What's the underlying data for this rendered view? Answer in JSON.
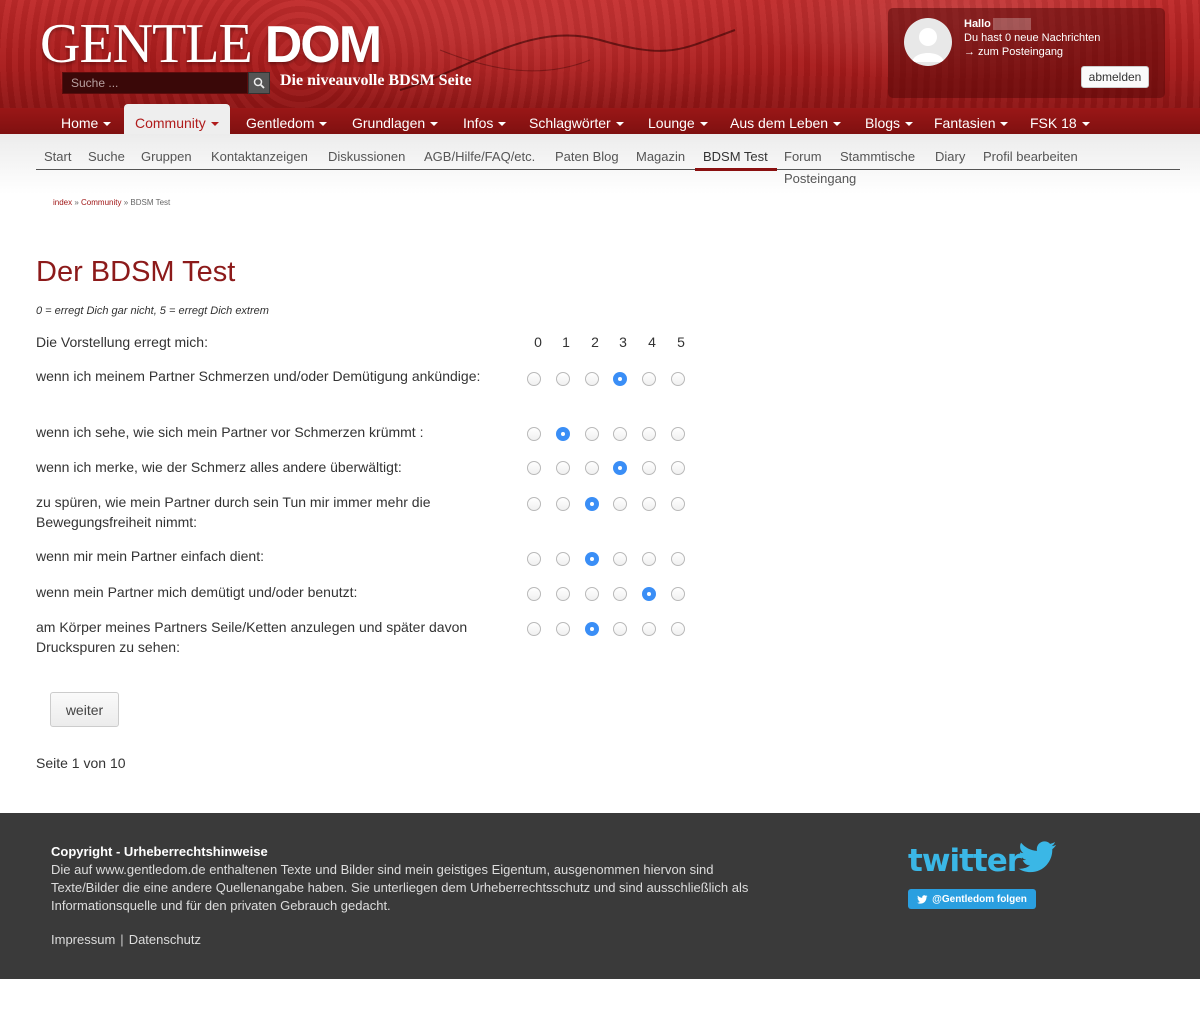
{
  "header": {
    "logo_part1": "GENTLE",
    "logo_part2": "DOM",
    "tagline": "Die niveauvolle BDSM Seite",
    "search_placeholder": "Suche ...",
    "search_icon": "search-icon"
  },
  "user": {
    "hello": "Hallo",
    "messages": "Du hast 0 neue Nachrichten",
    "inbox_link": "→ zum Posteingang",
    "logout": "abmelden",
    "avatar_icon": "user-avatar-icon"
  },
  "main_nav": [
    {
      "label": "Home"
    },
    {
      "label": "Community",
      "active": true
    },
    {
      "label": "Gentledom"
    },
    {
      "label": "Grundlagen"
    },
    {
      "label": "Infos"
    },
    {
      "label": "Schlagwörter"
    },
    {
      "label": "Lounge"
    },
    {
      "label": "Aus dem Leben"
    },
    {
      "label": "Blogs"
    },
    {
      "label": "Fantasien"
    },
    {
      "label": "FSK 18"
    }
  ],
  "sub_nav": [
    {
      "label": "Start"
    },
    {
      "label": "Suche"
    },
    {
      "label": "Gruppen"
    },
    {
      "label": "Kontaktanzeigen"
    },
    {
      "label": "Diskussionen"
    },
    {
      "label": "AGB/Hilfe/FAQ/etc."
    },
    {
      "label": "Paten Blog"
    },
    {
      "label": "Magazin"
    },
    {
      "label": "BDSM Test",
      "active": true
    },
    {
      "label": "Forum"
    },
    {
      "label": "Stammtische"
    },
    {
      "label": "Diary"
    },
    {
      "label": "Profil bearbeiten"
    },
    {
      "label": "Posteingang"
    }
  ],
  "breadcrumb": {
    "index": "index",
    "sep1": " » ",
    "community": "Community",
    "sep2": " » ",
    "current": "BDSM Test"
  },
  "test": {
    "title": "Der BDSM Test",
    "legend": "0 = erregt Dich gar nicht, 5 = erregt Dich extrem",
    "intro": "Die Vorstellung erregt mich:",
    "scale": [
      "0",
      "1",
      "2",
      "3",
      "4",
      "5"
    ],
    "questions": [
      {
        "text": "wenn ich meinem Partner Schmerzen und/oder Demütigung ankündige:",
        "selected": 3
      },
      {
        "text": "wenn ich sehe, wie sich mein Partner vor Schmerzen krümmt :",
        "selected": 1
      },
      {
        "text": "wenn ich merke, wie der Schmerz alles andere überwältigt:",
        "selected": 3
      },
      {
        "text": "zu spüren, wie mein Partner durch sein Tun mir immer mehr die Bewegungsfreiheit nimmt:",
        "selected": 2
      },
      {
        "text": "wenn mir mein Partner einfach dient:",
        "selected": 2
      },
      {
        "text": "wenn mein Partner mich demütigt und/oder benutzt:",
        "selected": 4
      },
      {
        "text": "am Körper meines Partners Seile/Ketten anzulegen und später davon Druckspuren zu sehen:",
        "selected": 2
      }
    ],
    "next_button": "weiter",
    "page_info": "Seite 1 von 10"
  },
  "footer": {
    "title": "Copyright - Urheberrechtshinweise",
    "text": "Die auf www.gentledom.de enthaltenen Texte und Bilder sind mein geistiges Eigentum, ausgenommen hiervon sind Texte/Bilder die eine andere Quellenangabe haben. Sie unterliegen dem Urheberrechtsschutz und sind ausschließlich als Informationsquelle und für den privaten Gebrauch gedacht.",
    "impressum": "Impressum",
    "separator": "|",
    "datenschutz": "Datenschutz",
    "twitter_logo": "twitter",
    "follow_button": "@Gentledom folgen"
  },
  "colors": {
    "brand_red": "#a81b1b",
    "title_red": "#8c1a1a",
    "radio_checked": "#3a8ef6",
    "footer_bg": "#3a3a3a",
    "twitter_blue": "#3ab7e6"
  }
}
